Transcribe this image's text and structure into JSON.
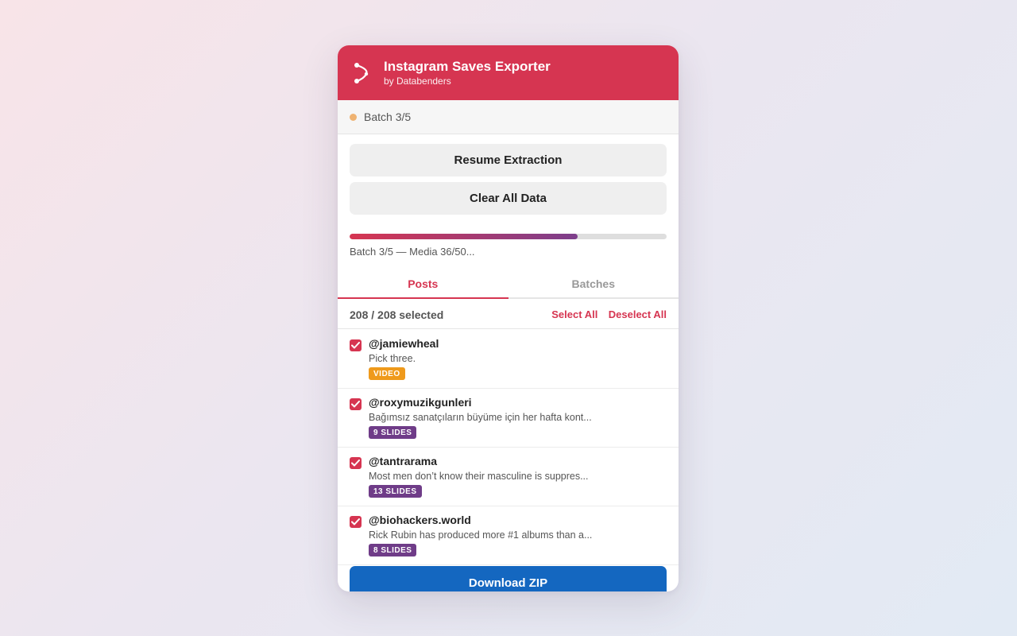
{
  "header": {
    "title": "Instagram Saves Exporter",
    "subtitle": "by Databenders",
    "logo_icon": "export-arrow-icon",
    "background": "#d63551"
  },
  "status": {
    "text": "Batch 3/5",
    "dot_color": "#efb372"
  },
  "actions": {
    "resume_label": "Resume Extraction",
    "clear_label": "Clear All Data"
  },
  "progress": {
    "value": 0.72,
    "text": "Batch 3/5 — Media 36/50..."
  },
  "tabs": [
    {
      "label": "Posts",
      "active": true
    },
    {
      "label": "Batches",
      "active": false
    }
  ],
  "selection": {
    "count_text": "208 / 208 selected",
    "select_all_label": "Select All",
    "deselect_all_label": "Deselect All"
  },
  "posts": [
    {
      "handle": "@jamiewheal",
      "caption": "Pick three.",
      "badge": "VIDEO",
      "badge_type": "video",
      "checked": true
    },
    {
      "handle": "@roxymuzikgunleri",
      "caption": "Bağımsız sanatçıların büyüme için her hafta kont...",
      "badge": "9 SLIDES",
      "badge_type": "slides",
      "checked": true
    },
    {
      "handle": "@tantrarama",
      "caption": "Most men don’t know their masculine is suppres...",
      "badge": "13 SLIDES",
      "badge_type": "slides",
      "checked": true
    },
    {
      "handle": "@biohackers.world",
      "caption": "Rick Rubin has produced more #1 albums than a...",
      "badge": "8 SLIDES",
      "badge_type": "slides",
      "checked": true
    }
  ],
  "download": {
    "label": "Download ZIP",
    "color": "#1467c0"
  },
  "colors": {
    "accent": "#d63551",
    "video_badge": "#ef9a1c",
    "slides_badge": "#6f3c88"
  }
}
